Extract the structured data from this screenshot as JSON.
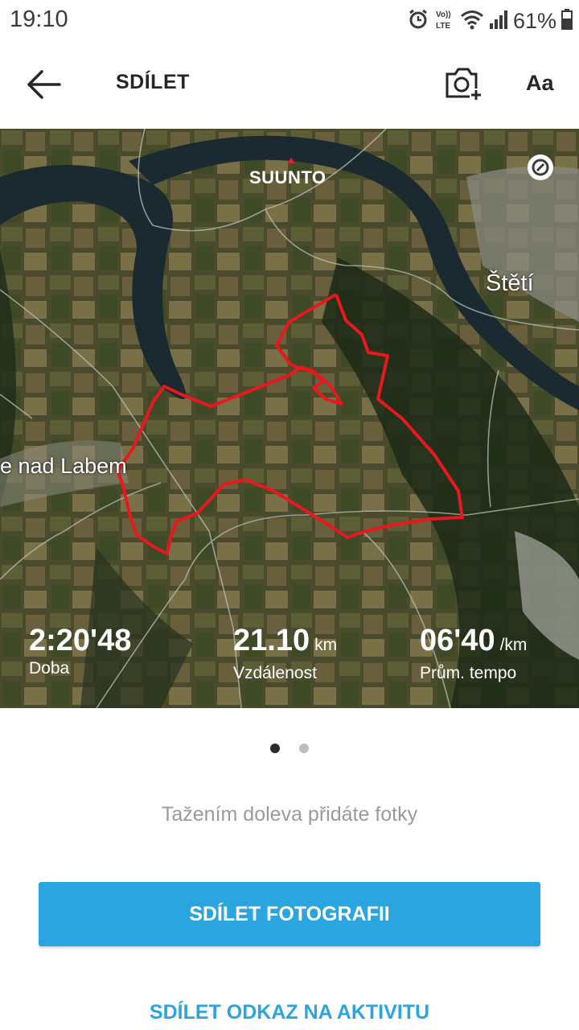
{
  "status_bar": {
    "time": "19:10",
    "volte_label": "Vo)) LTE",
    "battery": "61%",
    "icons": [
      "alarm-icon",
      "volte-icon",
      "wifi-icon",
      "signal-icon",
      "battery-icon"
    ]
  },
  "app_bar": {
    "title": "SDÍLET",
    "back_icon": "arrow-left-icon",
    "camera_icon": "camera-add-icon",
    "font_button": "Aa"
  },
  "map": {
    "brand": "SUUNTO",
    "places": [
      "Štětí",
      "e nad Labem"
    ],
    "info_icon": "map-info-icon",
    "route_color": "#e8191e"
  },
  "stats": [
    {
      "value": "2:20'48",
      "unit": "",
      "label": "Doba"
    },
    {
      "value": "21.10",
      "unit": "km",
      "label": "Vzdálenost"
    },
    {
      "value": "06'40",
      "unit": "/km",
      "label": "Prům. tempo"
    }
  ],
  "pager": {
    "count": 2,
    "active": 1
  },
  "hint": "Tažením doleva přidáte fotky",
  "buttons": {
    "share_photo": "SDÍLET FOTOGRAFII",
    "share_link": "SDÍLET ODKAZ NA AKTIVITU"
  },
  "colors": {
    "accent": "#2aa5e0",
    "route": "#e8191e"
  }
}
